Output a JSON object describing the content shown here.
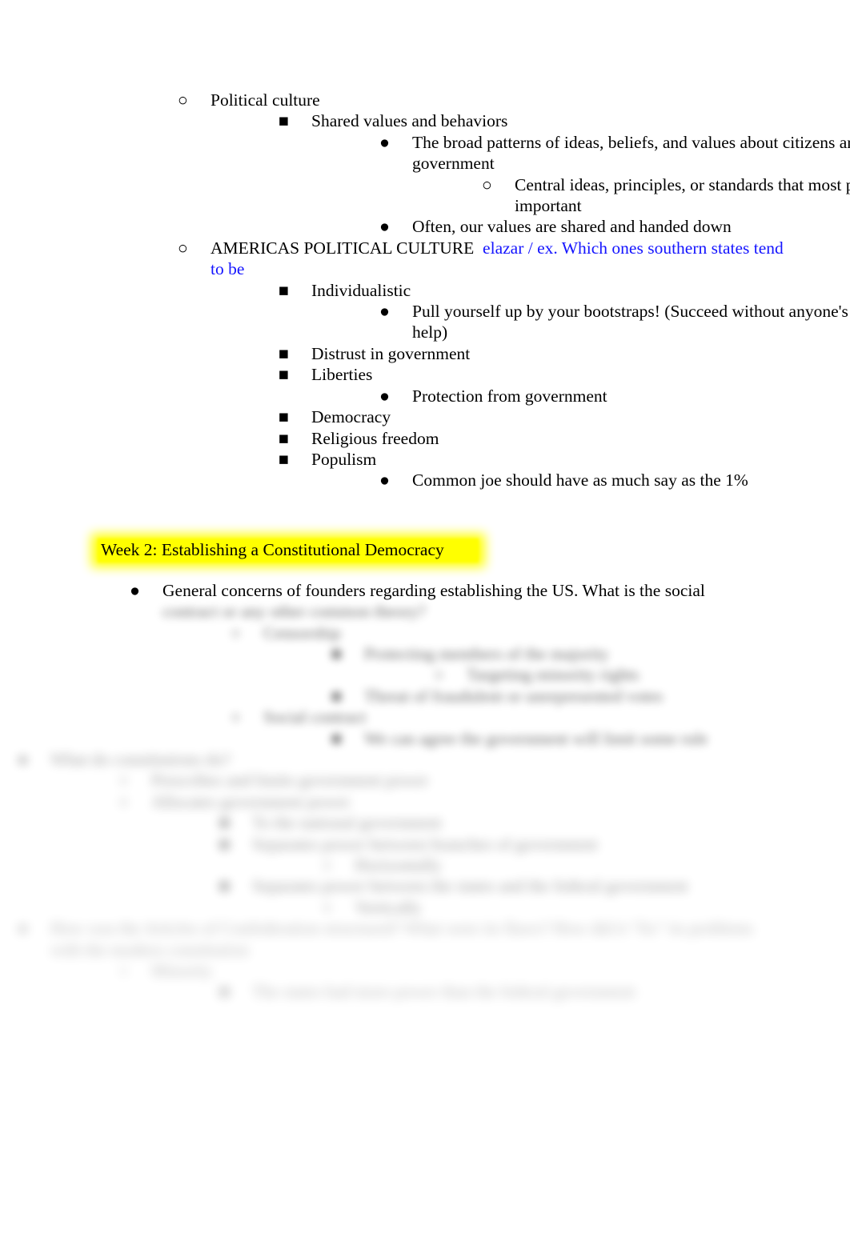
{
  "document": {
    "background_color": "#ffffff",
    "text_color": "#000000",
    "accent_blue": "#1414ff",
    "highlight_color": "#ffff00"
  },
  "bullets": {
    "circle": "○",
    "square": "■",
    "disc": "●"
  },
  "section_one": {
    "item_political_culture": "Political culture",
    "item_shared_values": "Shared values and behaviors",
    "item_broad_patterns": "The broad patterns of ideas, beliefs, and values about citizens and government",
    "item_central_ideas": "Central ideas, principles, or standards that most people agree are important",
    "item_often_values": "Often, our values are shared and handed down",
    "item_americas_political_culture": "AMERICAS POLITICAL CULTURE",
    "item_americas_note_blue": "elazar / ex. Which ones southern states tend to be",
    "item_individualistic": "Individualistic",
    "item_bootstraps": "Pull yourself up by your bootstraps! (Succeed without anyone's help)",
    "item_distrust": "Distrust in government",
    "item_liberties": "Liberties",
    "item_protection": "Protection from government",
    "item_democracy": "Democracy",
    "item_religious_freedom": "Religious freedom",
    "item_populism": "Populism",
    "item_common_joe": "Common joe should have as much say as the 1%"
  },
  "heading": {
    "week_two": "Week 2: Establishing a Constitutional Democracy"
  },
  "section_two": {
    "item_general_concerns": "General concerns of founders regarding establishing the US. What is the social",
    "blurred_lines": [
      "contract or any other common theory?",
      "Censorship",
      "Protecting members of the majority",
      "Targeting minority rights",
      "Threat of fraudulent or unrepresented votes",
      "Social contract",
      "We can agree the government will limit some rule",
      "What do constitutions do?",
      "Prescribes and limits government power",
      "Allocates government power",
      "To the national government",
      "Separates power between branches of government",
      "Horizontally",
      "Separates power between the states and the federal government",
      "Vertically",
      "How was the Articles of Confederation structured? What were its flaws? How did it \"fix\" its problems with the modern constitution",
      "Minority",
      "The states had more power than the federal government"
    ]
  }
}
